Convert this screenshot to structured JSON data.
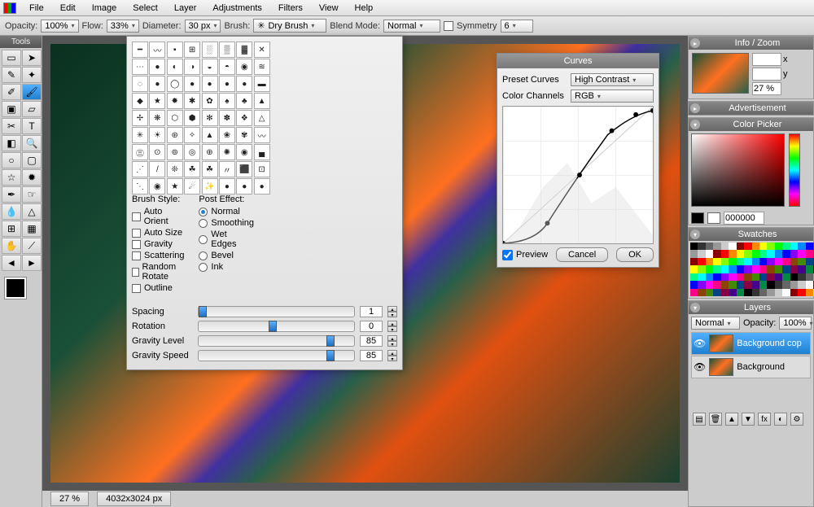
{
  "menu": [
    "File",
    "Edit",
    "Image",
    "Select",
    "Layer",
    "Adjustments",
    "Filters",
    "View",
    "Help"
  ],
  "options": {
    "opacity_label": "Opacity:",
    "opacity": "100%",
    "flow_label": "Flow:",
    "flow": "33%",
    "diameter_label": "Diameter:",
    "diameter": "30 px",
    "brush_label": "Brush:",
    "brush": "Dry Brush",
    "blendmode_label": "Blend Mode:",
    "blendmode": "Normal",
    "symmetry_label": "Symmetry",
    "symmetry": "6"
  },
  "tools_title": "Tools",
  "brush_popup": {
    "brush_style_label": "Brush Style:",
    "styles": [
      "Auto Orient",
      "Auto Size",
      "Gravity",
      "Scattering",
      "Random Rotate",
      "Outline"
    ],
    "post_effect_label": "Post Effect:",
    "effects": [
      "Normal",
      "Smoothing",
      "Wet Edges",
      "Bevel",
      "Ink"
    ],
    "effect_selected": "Normal",
    "spacing_label": "Spacing",
    "spacing": "1",
    "rotation_label": "Rotation",
    "rotation": "0",
    "gravity_level_label": "Gravity Level",
    "gravity_level": "85",
    "gravity_speed_label": "Gravity Speed",
    "gravity_speed": "85"
  },
  "curves": {
    "title": "Curves",
    "preset_label": "Preset Curves",
    "preset": "High Contrast",
    "channels_label": "Color Channels",
    "channels": "RGB",
    "preview_label": "Preview",
    "cancel": "Cancel",
    "ok": "OK"
  },
  "panels": {
    "infozoom": "Info / Zoom",
    "x": "x",
    "y": "y",
    "zoom": "27 %",
    "advertisement": "Advertisement",
    "colorpicker": "Color Picker",
    "hex": "000000",
    "swatches": "Swatches",
    "layers": "Layers",
    "blend": "Normal",
    "opacity_label": "Opacity:",
    "opacity": "100%",
    "layer_list": [
      "Background cop",
      "Background"
    ]
  },
  "status": {
    "zoom": "27 %",
    "dims": "4032x3024 px"
  }
}
